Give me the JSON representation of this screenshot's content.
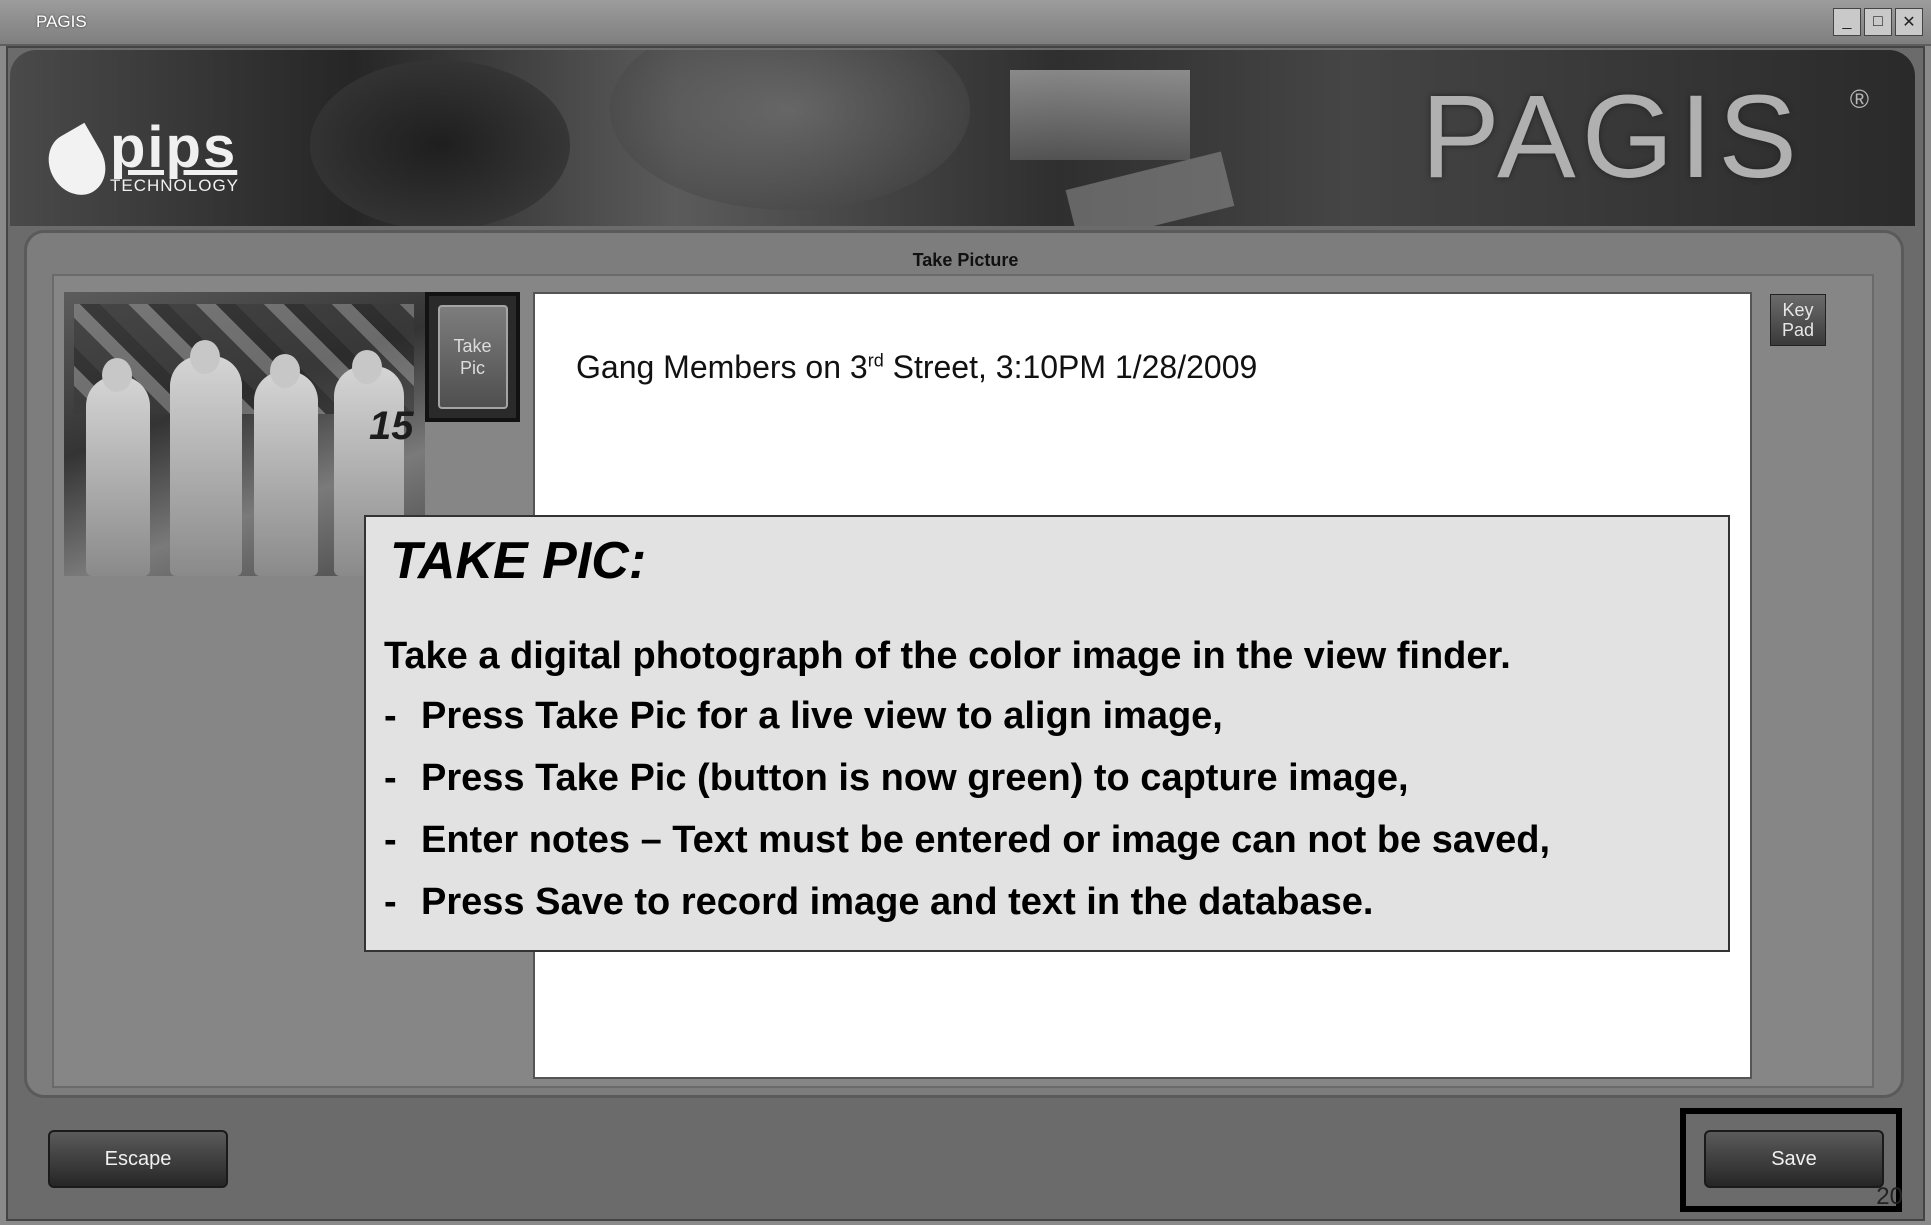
{
  "window": {
    "title": "PAGIS",
    "controls": [
      "minimize",
      "maximize",
      "close"
    ]
  },
  "banner": {
    "logo_main": "pips",
    "logo_sub": "TECHNOLOGY",
    "brand": "PAGIS",
    "brand_mark": "®"
  },
  "panel": {
    "title": "Take Picture"
  },
  "photo": {
    "jersey_number": "15"
  },
  "take_pic_button": {
    "label_line1": "Take",
    "label_line2": "Pic"
  },
  "notes": {
    "text_before": "Gang Members on 3",
    "text_sup": "rd",
    "text_after": " Street, 3:10PM 1/28/2009"
  },
  "keypad_button": {
    "line1": "Key",
    "line2": "Pad"
  },
  "callout": {
    "heading": "TAKE PIC:",
    "lead": "Take a digital photograph of the color image in the view finder.",
    "steps": [
      "Press Take Pic for a live view to align image,",
      "Press Take Pic (button is now green) to capture image,",
      "Enter notes – Text must be entered or image can not be saved,",
      "Press Save to record image and text in the database."
    ],
    "bullet": "-"
  },
  "buttons": {
    "escape": "Escape",
    "save": "Save"
  },
  "page_number": "20"
}
